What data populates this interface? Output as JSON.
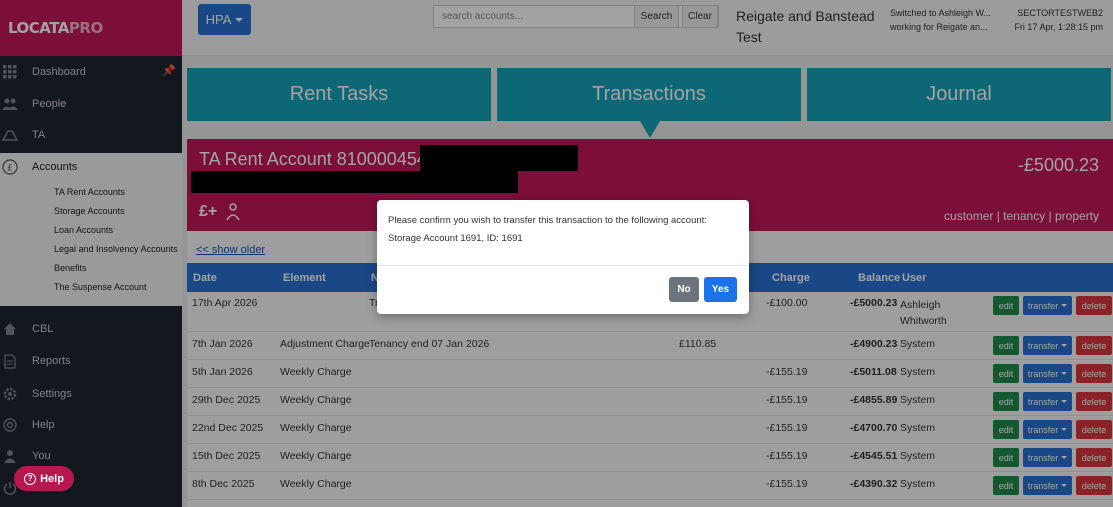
{
  "brand": {
    "logo_main": "LOCATA",
    "logo_accent": "PRO"
  },
  "sidebar": {
    "items": [
      {
        "label": "Dashboard",
        "icon": "grid-icon"
      },
      {
        "label": "People",
        "icon": "people-icon"
      },
      {
        "label": "TA",
        "icon": "ta-icon"
      },
      {
        "label": "Accounts",
        "icon": "pound-icon"
      },
      {
        "label": "CBL",
        "icon": "home-icon"
      },
      {
        "label": "Reports",
        "icon": "document-icon"
      },
      {
        "label": "Settings",
        "icon": "gear-icon"
      },
      {
        "label": "Help",
        "icon": "lifebuoy-icon"
      },
      {
        "label": "You",
        "icon": "user-icon"
      }
    ],
    "sub_items": [
      "TA Rent Accounts",
      "Storage Accounts",
      "Loan Accounts",
      "Legal and Insolvency Accounts",
      "Benefits",
      "The Suspense Account"
    ],
    "help_button": "Help"
  },
  "header": {
    "org_button": "HPA",
    "search_placeholder": "search accounts...",
    "search_label": "Search",
    "clear_label": "Clear",
    "org_name": "Reigate and Banstead Test",
    "switched_line1": "Switched to Ashleigh W...",
    "switched_line2": "working for Reigate an...",
    "server": "SECTORTESTWEB2",
    "datetime": "Fri 17 Apr, 1:28:15 pm"
  },
  "tabs": [
    "Rent Tasks",
    "Transactions",
    "Journal"
  ],
  "account": {
    "title": "TA Rent Account 810000454:",
    "balance": "-£5000.23",
    "icon_text": "£+",
    "links": "customer | tenancy | property"
  },
  "table": {
    "show_older": "<< show older",
    "columns": [
      "Date",
      "Element",
      "N",
      "Charge",
      "Balance",
      "User"
    ],
    "actions": {
      "edit": "edit",
      "transfer": "transfer",
      "delete": "delete"
    },
    "rows": [
      {
        "date": "17th Apr 2026",
        "element": "",
        "note": "Tr",
        "credit": "",
        "charge": "-£100.00",
        "balance": "-£5000.23",
        "user": "Ashleigh Whitworth"
      },
      {
        "date": "7th Jan 2026",
        "element": "Adjustment Charge",
        "note": "Tenancy end 07 Jan 2026",
        "credit": "£110.85",
        "charge": "",
        "balance": "-£4900.23",
        "user": "System"
      },
      {
        "date": "5th Jan 2026",
        "element": "Weekly Charge",
        "note": "",
        "credit": "",
        "charge": "-£155.19",
        "balance": "-£5011.08",
        "user": "System"
      },
      {
        "date": "29th Dec 2025",
        "element": "Weekly Charge",
        "note": "",
        "credit": "",
        "charge": "-£155.19",
        "balance": "-£4855.89",
        "user": "System"
      },
      {
        "date": "22nd Dec 2025",
        "element": "Weekly Charge",
        "note": "",
        "credit": "",
        "charge": "-£155.19",
        "balance": "-£4700.70",
        "user": "System"
      },
      {
        "date": "15th Dec 2025",
        "element": "Weekly Charge",
        "note": "",
        "credit": "",
        "charge": "-£155.19",
        "balance": "-£4545.51",
        "user": "System"
      },
      {
        "date": "8th Dec 2025",
        "element": "Weekly Charge",
        "note": "",
        "credit": "",
        "charge": "-£155.19",
        "balance": "-£4390.32",
        "user": "System"
      }
    ]
  },
  "modal": {
    "line1": "Please confirm you wish to transfer this transaction to the following account:",
    "line2": "Storage Account 1691, ID: 1691",
    "no_label": "No",
    "yes_label": "Yes"
  },
  "colors": {
    "brand": "#c2185b",
    "tab": "#17a2b8",
    "primary": "#2a6fd0",
    "edit": "#1e8a4a",
    "delete": "#d9363e",
    "sidebar": "#1f2430"
  }
}
